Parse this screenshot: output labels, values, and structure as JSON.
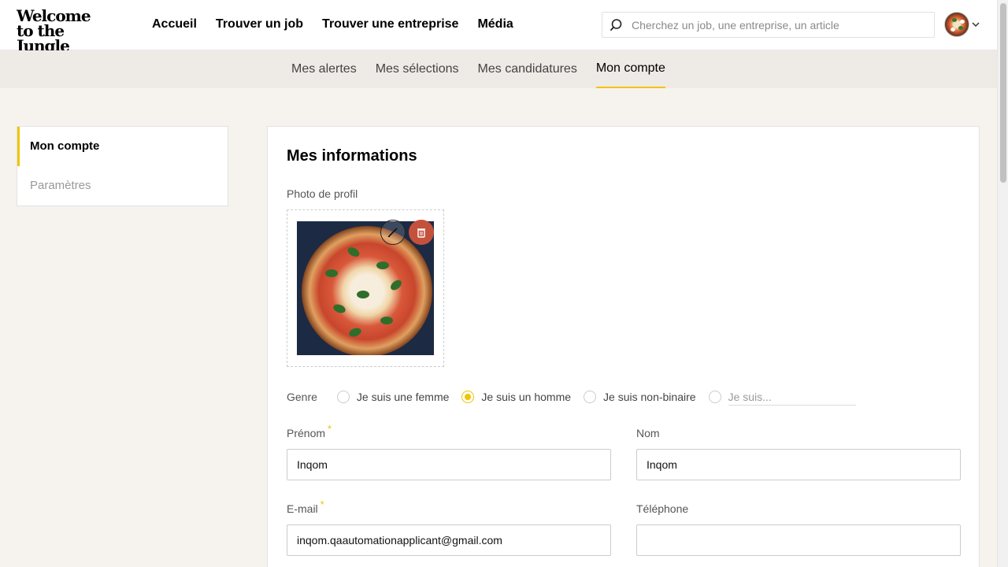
{
  "header": {
    "logo_line1": "Welcome",
    "logo_line2": "to the Jungle",
    "nav": [
      "Accueil",
      "Trouver un job",
      "Trouver une entreprise",
      "Média"
    ],
    "search_placeholder": "Cherchez un job, une entreprise, un article",
    "search_icon": "search-icon",
    "avatar_icon": "user-avatar",
    "menu_icon": "chevron-down-icon"
  },
  "subnav": {
    "tabs": [
      "Mes alertes",
      "Mes sélections",
      "Mes candidatures",
      "Mon compte"
    ],
    "active": "Mon compte"
  },
  "sidebar": {
    "items": [
      "Mon compte",
      "Paramètres"
    ],
    "active": "Mon compte"
  },
  "main": {
    "title": "Mes informations",
    "photo_label": "Photo de profil",
    "photo_edit_icon": "pencil-icon",
    "photo_delete_icon": "trash-icon",
    "genre": {
      "label": "Genre",
      "options": [
        "Je suis une femme",
        "Je suis un homme",
        "Je suis non-binaire"
      ],
      "selected": "Je suis un homme",
      "other_placeholder": "Je suis..."
    },
    "prenom": {
      "label": "Prénom",
      "required_mark": "*",
      "value": "Inqom"
    },
    "nom": {
      "label": "Nom",
      "value": "Inqom"
    },
    "email": {
      "label": "E-mail",
      "required_mark": "*",
      "value": "inqom.qaautomationapplicant@gmail.com"
    },
    "telephone": {
      "label": "Téléphone",
      "value": ""
    }
  },
  "colors": {
    "accent": "#f1c400",
    "page_bg": "#f6f3ef",
    "subnav_bg": "#eeeae5",
    "delete_red": "#c4513c"
  }
}
